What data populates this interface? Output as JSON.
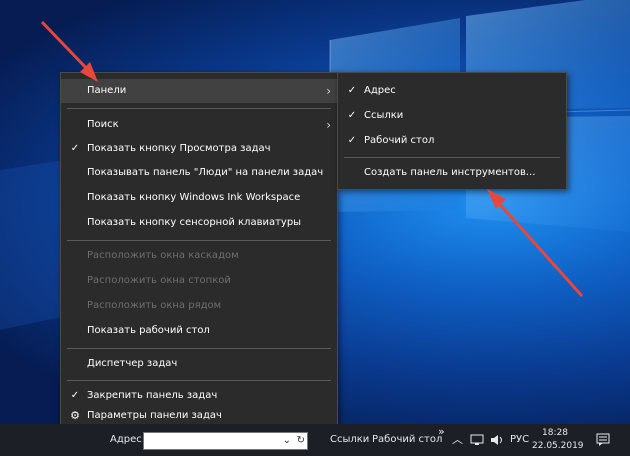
{
  "main_menu": {
    "items": [
      {
        "label": "Панели",
        "checked": false,
        "submenu": true,
        "disabled": false
      },
      {
        "label": "Поиск",
        "checked": false,
        "submenu": true,
        "disabled": false
      },
      {
        "label": "Показать кнопку Просмотра задач",
        "checked": true,
        "submenu": false,
        "disabled": false
      },
      {
        "label": "Показывать панель \"Люди\" на панели задач",
        "checked": false,
        "submenu": false,
        "disabled": false
      },
      {
        "label": "Показать кнопку Windows Ink Workspace",
        "checked": false,
        "submenu": false,
        "disabled": false
      },
      {
        "label": "Показать кнопку сенсорной клавиатуры",
        "checked": false,
        "submenu": false,
        "disabled": false
      },
      {
        "label": "Расположить окна каскадом",
        "checked": false,
        "submenu": false,
        "disabled": true
      },
      {
        "label": "Расположить окна стопкой",
        "checked": false,
        "submenu": false,
        "disabled": true
      },
      {
        "label": "Расположить окна рядом",
        "checked": false,
        "submenu": false,
        "disabled": true
      },
      {
        "label": "Показать рабочий стол",
        "checked": false,
        "submenu": false,
        "disabled": false
      },
      {
        "label": "Диспетчер задач",
        "checked": false,
        "submenu": false,
        "disabled": false
      },
      {
        "label": "Закрепить панель задач",
        "checked": true,
        "submenu": false,
        "disabled": false
      },
      {
        "label": "Параметры панели задач",
        "checked": false,
        "submenu": false,
        "disabled": false,
        "icon": "gear-icon"
      }
    ],
    "check_mark": "✓",
    "submenu_arrow": "›",
    "gear_glyph": "⚙"
  },
  "sub_menu": {
    "items": [
      {
        "label": "Адрес",
        "checked": true
      },
      {
        "label": "Ссылки",
        "checked": true
      },
      {
        "label": "Рабочий стол",
        "checked": true
      },
      {
        "label": "Создать панель инструментов...",
        "checked": false
      }
    ]
  },
  "taskbar": {
    "address_label": "Адрес",
    "address_value": "",
    "dropdown_glyph": "⌄",
    "refresh_glyph": "↻",
    "links_label": "Ссылки",
    "desktop_label": "Рабочий стол",
    "overflow_glyph": "»",
    "tray_up_glyph": "︿",
    "language": "РУС",
    "time": "18:28",
    "date": "22.05.2019",
    "notification_glyph": "🗨"
  },
  "colors": {
    "menu_bg": "#2b2b2b",
    "menu_highlight": "#414141",
    "taskbar_bg": "#1c2026",
    "annotation_arrow": "#e8473a"
  }
}
